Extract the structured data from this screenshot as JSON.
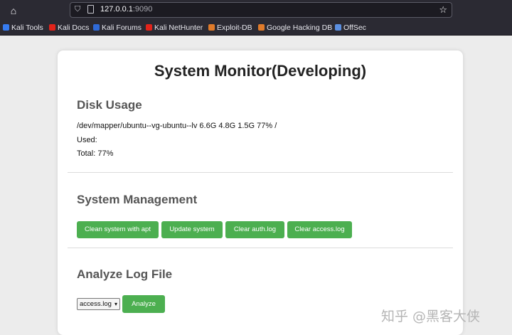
{
  "browser": {
    "url_host": "127.0.0.1",
    "url_port": ":9090",
    "bookmarks": [
      {
        "label": "Kali Tools",
        "color": "#367bf0"
      },
      {
        "label": "Kali Docs",
        "color": "#e2231a"
      },
      {
        "label": "Kali Forums",
        "color": "#2f6ad8"
      },
      {
        "label": "Kali NetHunter",
        "color": "#e2231a"
      },
      {
        "label": "Exploit-DB",
        "color": "#e07b2a"
      },
      {
        "label": "Google Hacking DB",
        "color": "#e07b2a"
      },
      {
        "label": "OffSec",
        "color": "#5b8fe0"
      }
    ]
  },
  "page": {
    "title": "System Monitor(Developing)",
    "disk": {
      "heading": "Disk Usage",
      "line1": "/dev/mapper/ubuntu--vg-ubuntu--lv 6.6G 4.8G 1.5G 77% /",
      "used": "Used:",
      "total": "Total: 77%"
    },
    "management": {
      "heading": "System Management",
      "buttons": [
        "Clean system with apt",
        "Update system",
        "Clear auth.log",
        "Clear access.log"
      ]
    },
    "analyze": {
      "heading": "Analyze Log File",
      "selected": "access.log",
      "button": "Analyze"
    }
  },
  "watermark": "知乎 @黑客大侠",
  "colors": {
    "accent": "#4caf50",
    "chrome": "#2b2a33"
  }
}
